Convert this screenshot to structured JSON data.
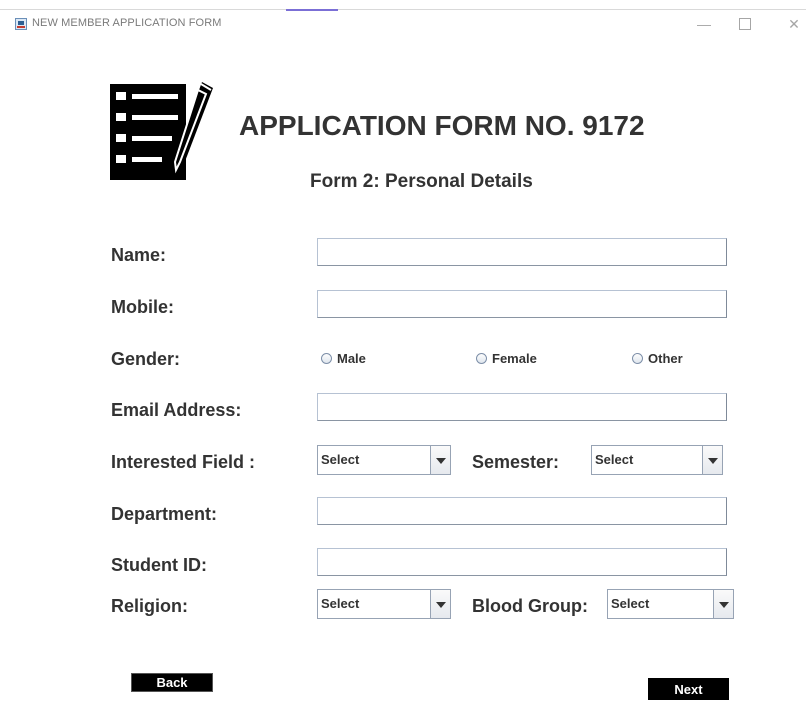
{
  "window": {
    "title": "NEW MEMBER APPLICATION FORM",
    "controls": {
      "minimize": "—",
      "close": "✕"
    }
  },
  "header": {
    "title": "APPLICATION FORM NO. 9172",
    "subtitle": "Form 2: Personal Details",
    "logo_icon": "form-checklist-pencil-icon"
  },
  "form": {
    "name": {
      "label": "Name:",
      "value": ""
    },
    "mobile": {
      "label": "Mobile:",
      "value": ""
    },
    "gender": {
      "label": "Gender:",
      "options": [
        "Male",
        "Female",
        "Other"
      ],
      "selected": null
    },
    "email": {
      "label": "Email Address:",
      "value": ""
    },
    "interested_field": {
      "label": "Interested Field :",
      "selected": "Select"
    },
    "semester": {
      "label": "Semester:",
      "selected": "Select"
    },
    "department": {
      "label": "Department:",
      "value": ""
    },
    "student_id": {
      "label": "Student ID:",
      "value": ""
    },
    "religion": {
      "label": "Religion:",
      "selected": "Select"
    },
    "blood_group": {
      "label": "Blood Group:",
      "selected": "Select"
    }
  },
  "actions": {
    "back_label": "Back",
    "next_label": "Next"
  },
  "colors": {
    "accent_tab": "#7b6fd6",
    "text": "#333333",
    "button_bg": "#000000",
    "button_text": "#ffffff"
  }
}
